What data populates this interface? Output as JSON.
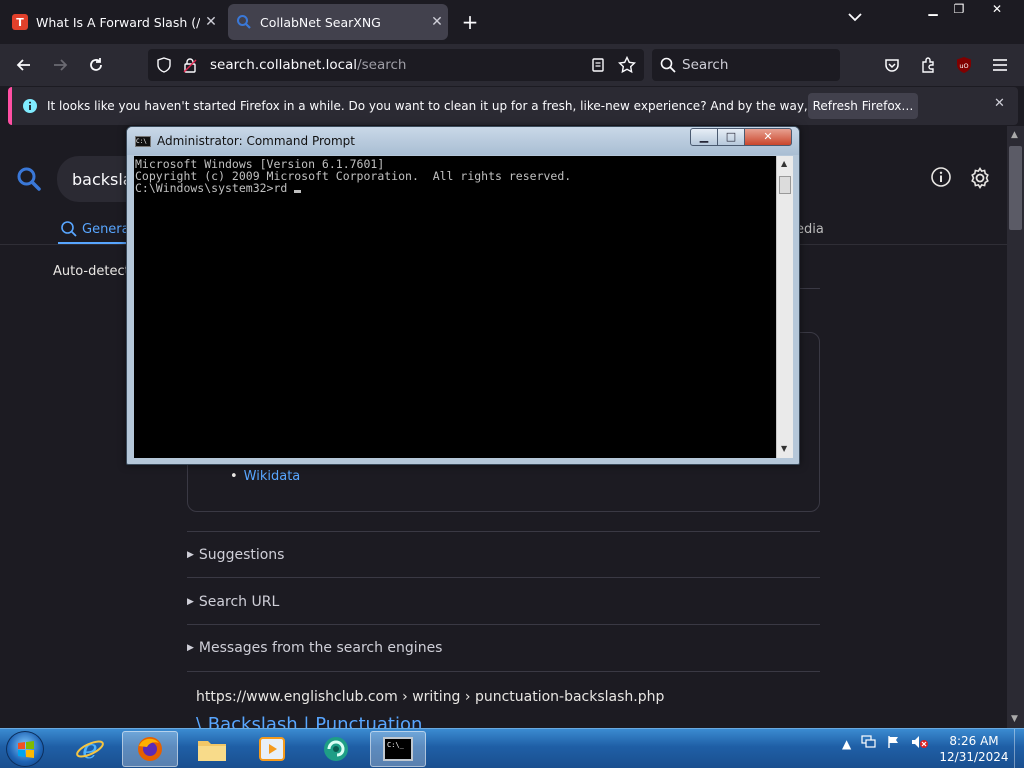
{
  "browser": {
    "tabs": [
      {
        "title": "What Is A Forward Slash (/) & H",
        "favicon": "T"
      },
      {
        "title": "CollabNet SearXNG"
      }
    ],
    "url_host": "search.collabnet.local",
    "url_path": "/search",
    "search_placeholder": "Search",
    "notification": "It looks like you haven't started Firefox in a while. Do you want to clean it up for a fresh, like-new experience? And by the way, welcome back!",
    "refresh_button": "Refresh Firefox…",
    "accent": "#ff4fa3"
  },
  "page": {
    "query_value": "backslash",
    "category_general": "General",
    "category_media": "edia",
    "autodetect": "Auto-detect",
    "wikidata_link": "Wikidata",
    "sections": [
      "Suggestions",
      "Search URL",
      "Messages from the search engines"
    ],
    "result_url": "https://www.englishclub.com  › writing › punctuation-backslash.php",
    "result_title": "\\ Backslash | Punctuation",
    "link_color": "#58a6ff"
  },
  "cmd": {
    "title": "Administrator: Command Prompt",
    "icon_text": "C:\\",
    "lines": [
      "Microsoft Windows [Version 6.1.7601]",
      "Copyright (c) 2009 Microsoft Corporation.  All rights reserved.",
      "",
      "C:\\Windows\\system32>rd "
    ]
  },
  "taskbar": {
    "time": "8:26 AM",
    "date": "12/31/2024",
    "cmd_icon_text": "C:\\_"
  }
}
